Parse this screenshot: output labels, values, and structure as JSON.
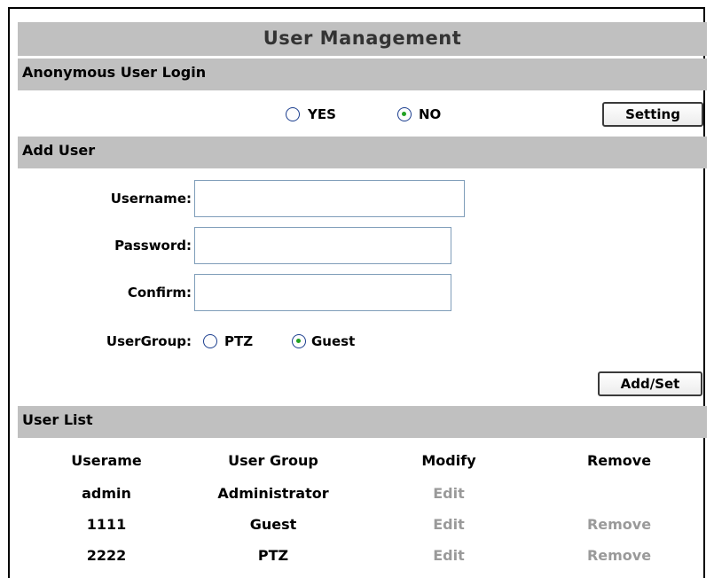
{
  "title": "User Management",
  "anonymous": {
    "section_label": "Anonymous User Login",
    "options": [
      {
        "label": "YES",
        "checked": false
      },
      {
        "label": "NO",
        "checked": true
      }
    ],
    "setting_button": "Setting"
  },
  "add_user": {
    "section_label": "Add User",
    "username_label": "Username:",
    "username_value": "",
    "password_label": "Password:",
    "password_value": "",
    "confirm_label": "Confirm:",
    "confirm_value": "",
    "usergroup_label": "UserGroup:",
    "groups": [
      {
        "label": "PTZ",
        "checked": false
      },
      {
        "label": "Guest",
        "checked": true
      }
    ],
    "add_button": "Add/Set"
  },
  "user_list": {
    "section_label": "User List",
    "headers": [
      "Userame",
      "User Group",
      "Modify",
      "Remove"
    ],
    "rows": [
      {
        "username": "admin",
        "group": "Administrator",
        "modify": "Edit",
        "remove": ""
      },
      {
        "username": "1111",
        "group": "Guest",
        "modify": "Edit",
        "remove": "Remove"
      },
      {
        "username": "2222",
        "group": "PTZ",
        "modify": "Edit",
        "remove": "Remove"
      }
    ]
  },
  "colors": {
    "band": "#c0c0c0",
    "link_disabled": "#9a9a9a",
    "radio_dot": "#21a121",
    "radio_border": "#1c3f8f"
  }
}
